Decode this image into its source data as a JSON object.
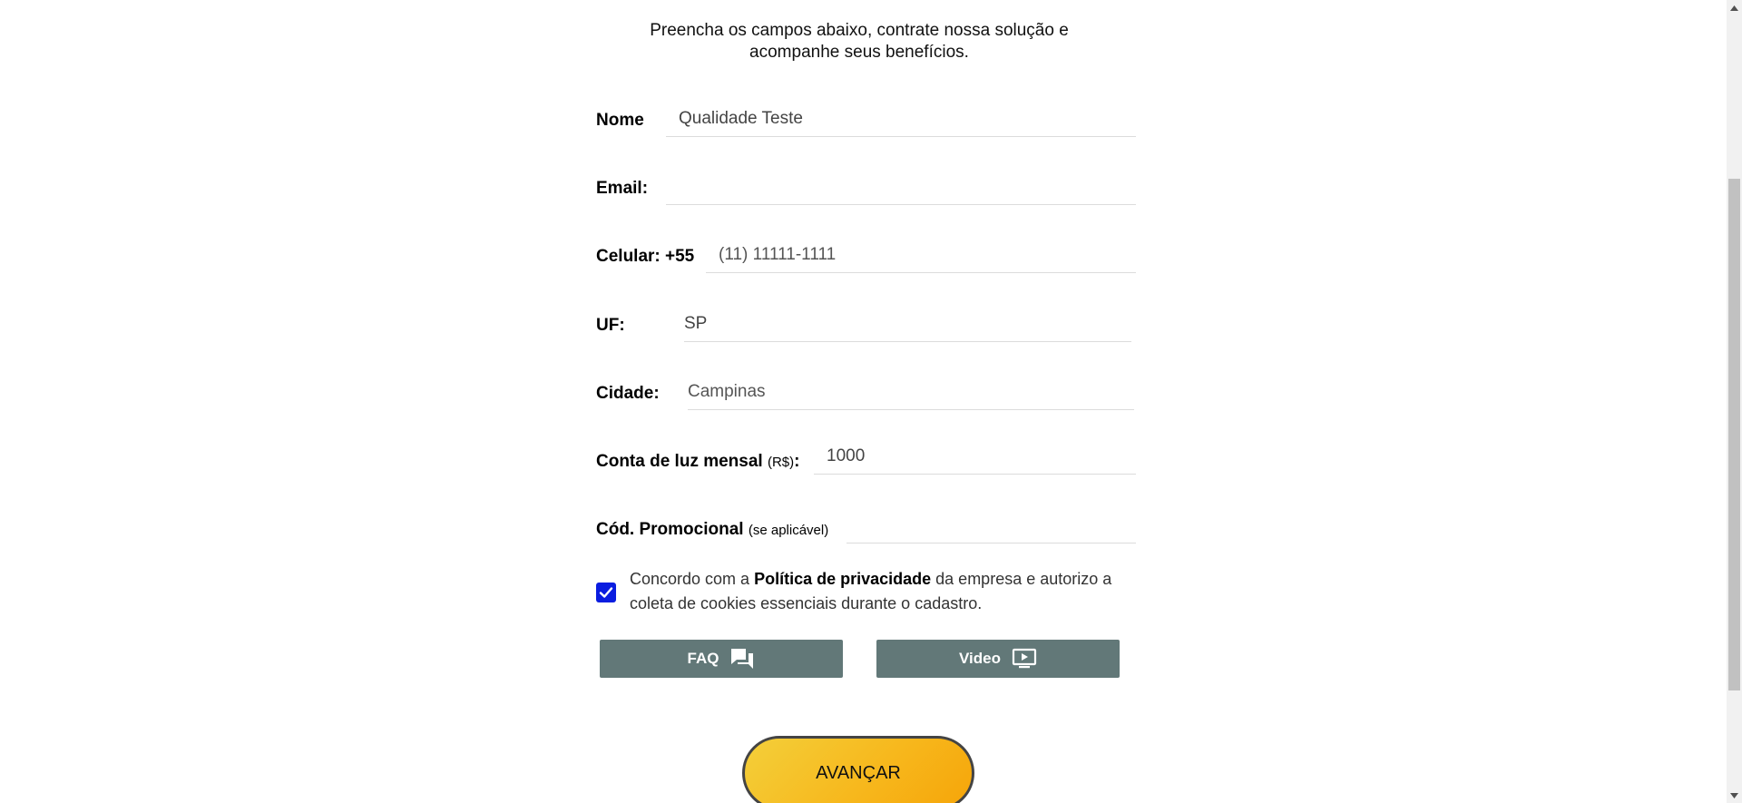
{
  "intro": {
    "line1": "Preencha os campos abaixo, contrate nossa solução e",
    "line2": "acompanhe seus benefícios."
  },
  "form": {
    "nome": {
      "label": "Nome",
      "value": "Qualidade Teste"
    },
    "email": {
      "label": "Email:",
      "value": ""
    },
    "celular": {
      "label": "Celular: +55",
      "placeholder": "(11) 11111-1111"
    },
    "uf": {
      "label": "UF:",
      "value": "SP"
    },
    "cidade": {
      "label": "Cidade:",
      "placeholder": "Campinas"
    },
    "conta": {
      "label": "Conta de luz mensal",
      "unit": "(R$)",
      "colon": ":",
      "value": "1000"
    },
    "promo": {
      "label": "Cód. Promocional",
      "hint": "(se aplicável)",
      "value": ""
    }
  },
  "consent": {
    "checked": true,
    "text_before": "Concordo com a ",
    "link": "Política de privacidade",
    "text_after": " da empresa e autorizo a coleta de cookies essenciais durante o cadastro."
  },
  "buttons": {
    "faq": {
      "label": "FAQ",
      "icon": "chat-bubbles-icon"
    },
    "video": {
      "label": "Video",
      "icon": "play-screen-icon"
    },
    "advance": {
      "label": "AVANÇAR"
    }
  },
  "colors": {
    "secondary_button": "#627878",
    "checkbox": "#0a1de0",
    "advance_gradient_start": "#f3cf3a",
    "advance_gradient_end": "#f6a509"
  }
}
